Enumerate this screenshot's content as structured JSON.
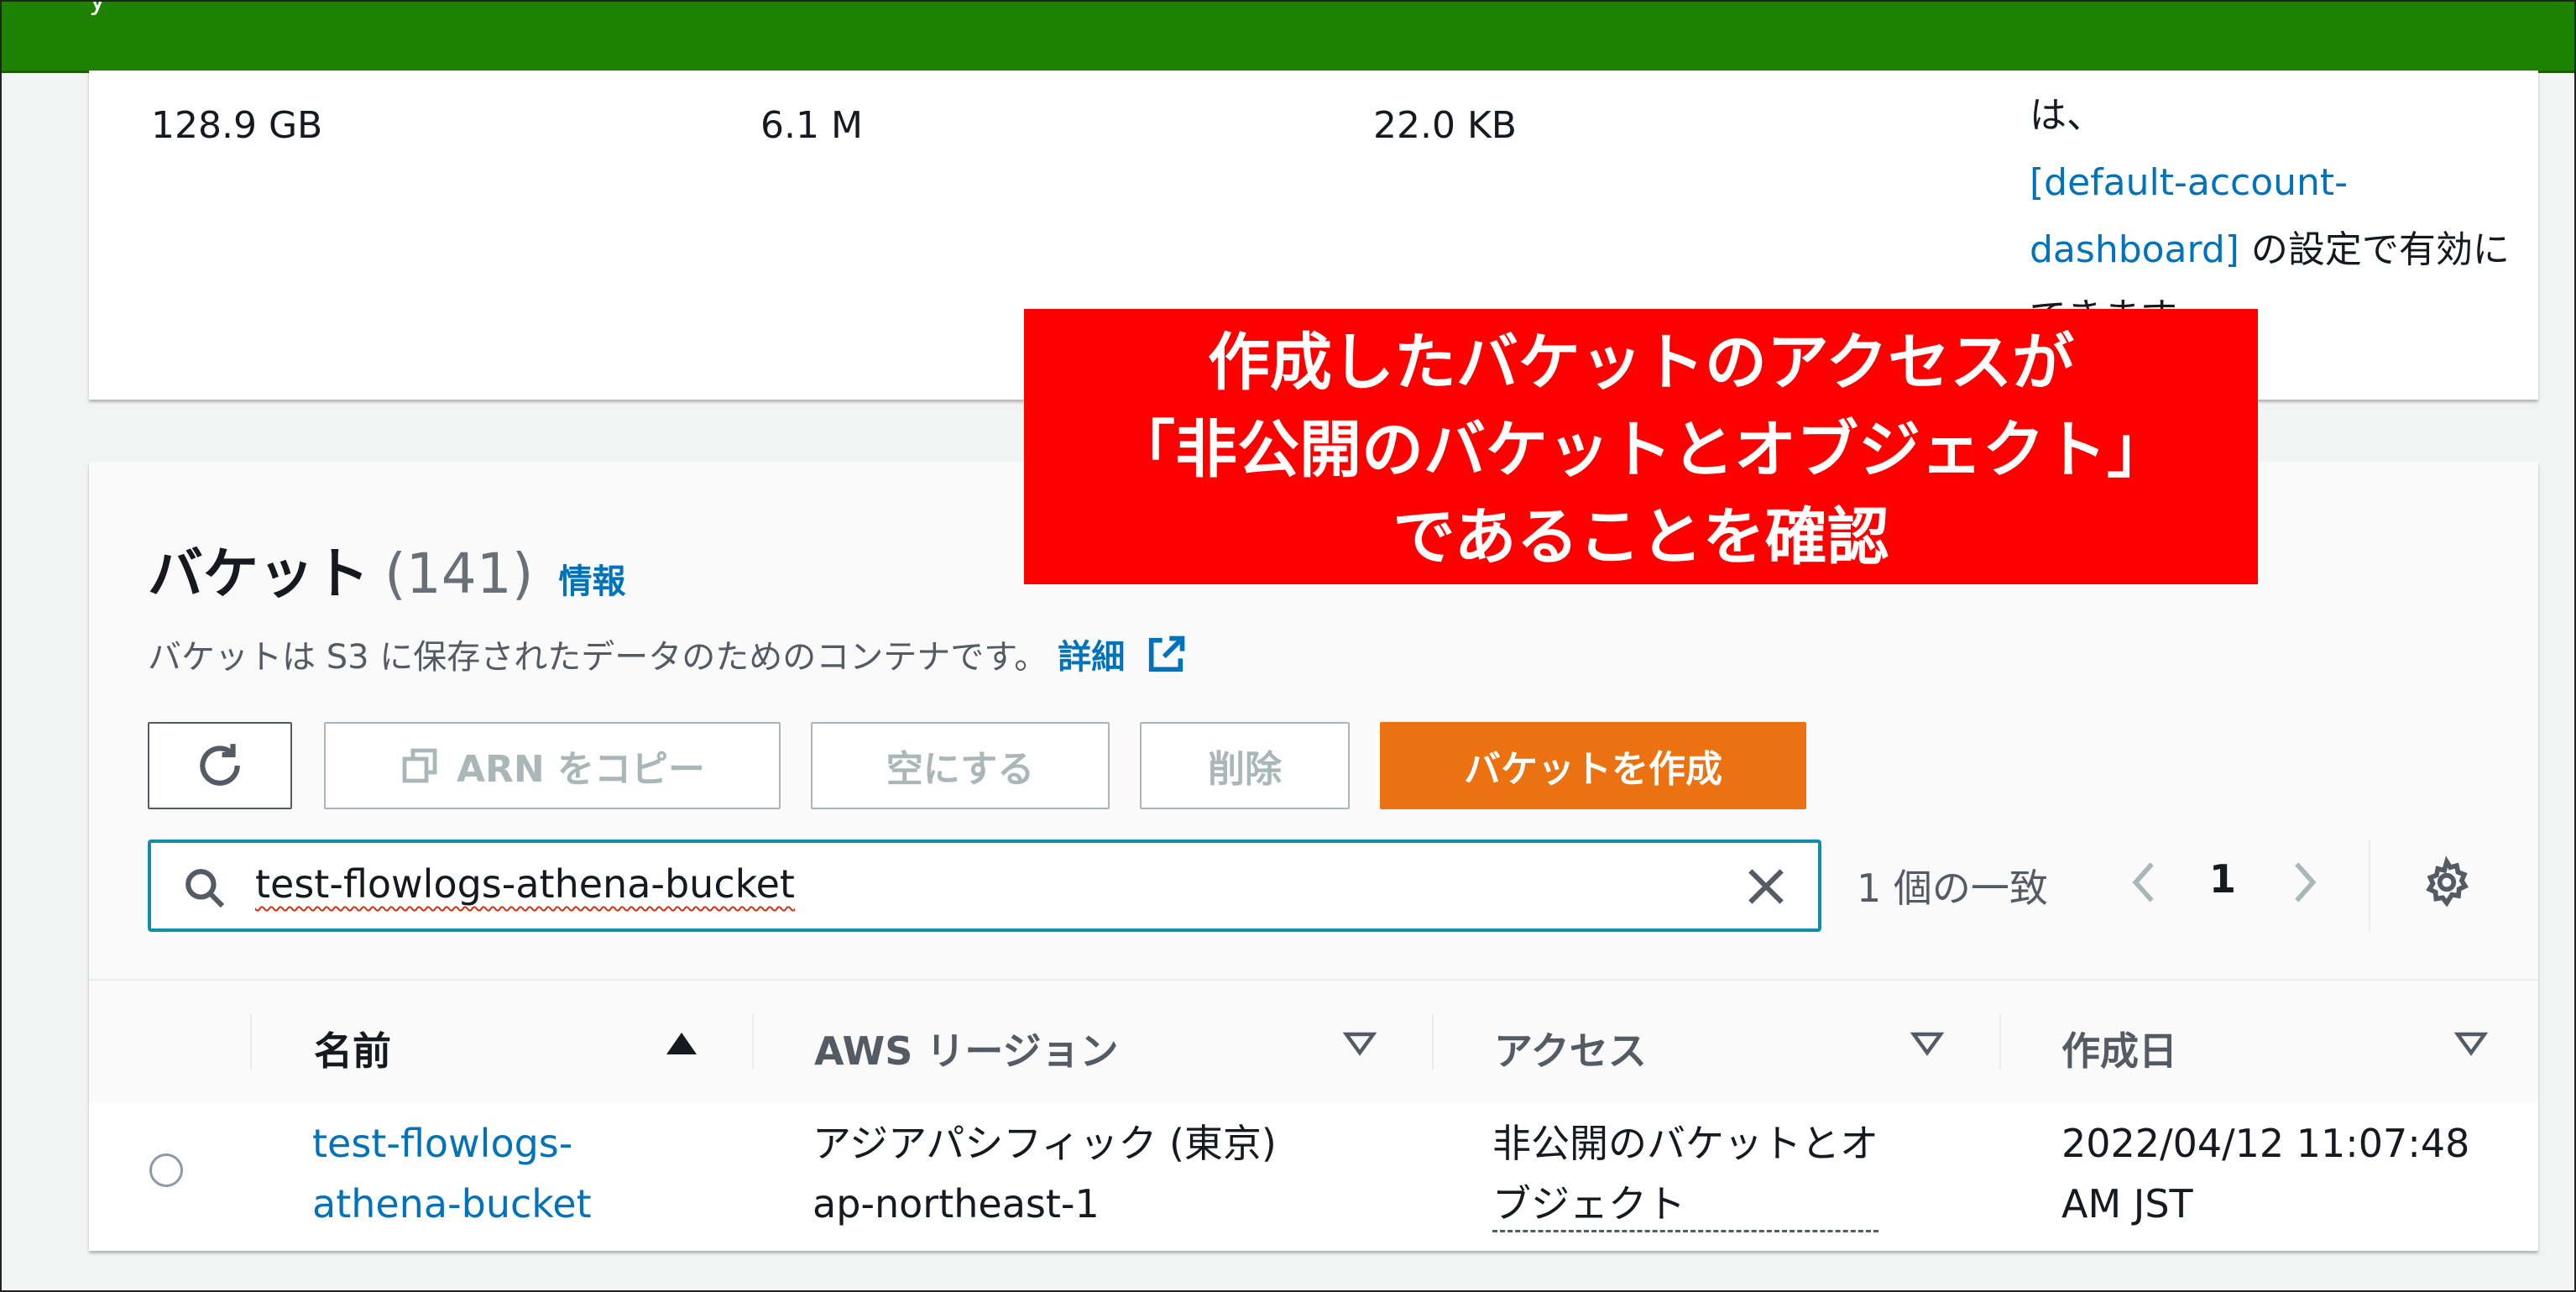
{
  "topbar": {
    "stub_text": "y"
  },
  "metrics": {
    "total_storage": "128.9 GB",
    "object_count": "6.1 M",
    "avg_object_size": "22.0 KB",
    "note_line1": "は、",
    "note_link_1": "[default-account-",
    "note_link_2": "dashboard]",
    "note_rest": " の設定で有効に",
    "note_line4": "できます。"
  },
  "buckets": {
    "title": "バケット",
    "count": "(141)",
    "info_link": "情報",
    "description": "バケットは S3 に保存されたデータのためのコンテナです。",
    "learn_more": "詳細",
    "buttons": {
      "copy_arn": "ARN をコピー",
      "empty": "空にする",
      "delete": "削除",
      "create": "バケットを作成"
    },
    "search_value": "test-flowlogs-athena-bucket",
    "matches": "1 個の一致",
    "page": "1",
    "columns": {
      "name": "名前",
      "region": "AWS リージョン",
      "access": "アクセス",
      "created": "作成日"
    },
    "rows": [
      {
        "name_line1": "test-flowlogs-",
        "name_line2": "athena-bucket",
        "region_line1": "アジアパシフィック (東京)",
        "region_line2": "ap-northeast-1",
        "access_line1": "非公開のバケットとオ",
        "access_line2": "ブジェクト",
        "created_line1": "2022/04/12 11:07:48",
        "created_line2": "AM JST"
      }
    ]
  },
  "callout": {
    "line1": "作成したバケットのアクセスが",
    "line2": "「非公開のバケットとオブジェクト」",
    "line3": "であることを確認"
  },
  "colors": {
    "topbar": "#1d8102",
    "link": "#0073bb",
    "primary_button": "#ec7211",
    "callout": "#ff0000",
    "search_border": "#0f8fa8"
  }
}
